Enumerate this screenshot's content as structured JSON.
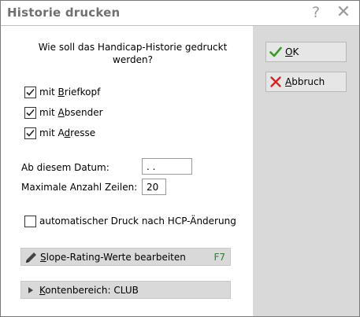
{
  "window": {
    "title": "Historie drucken",
    "help_glyph": "?",
    "close_glyph": "✕"
  },
  "question": "Wie soll das Handicap-Historie gedruckt werden?",
  "checkboxes": [
    {
      "pre": "mit ",
      "mnemonic": "B",
      "post": "riefkopf",
      "checked": true
    },
    {
      "pre": "mit ",
      "mnemonic": "A",
      "post": "bsender",
      "checked": true
    },
    {
      "pre": "mit A",
      "mnemonic": "d",
      "post": "resse",
      "checked": true
    }
  ],
  "fields": {
    "date_label": "Ab diesem Datum:",
    "date_value": " .  .",
    "max_rows_label": "Maximale Anzahl Zeilen:",
    "max_rows_value": "20"
  },
  "auto_print": {
    "label": "automatischer Druck nach HCP-Änderung",
    "checked": false
  },
  "slope_bar": {
    "mnemonic": "S",
    "rest": "lope-Rating-Werte bearbeiten",
    "shortcut": "F7"
  },
  "konten_bar": {
    "mnemonic": "K",
    "rest": "ontenbereich: CLUB"
  },
  "buttons": {
    "ok": {
      "mnemonic": "O",
      "rest": "K"
    },
    "cancel": {
      "mnemonic": "A",
      "rest": "bbruch"
    }
  },
  "colors": {
    "ok_icon": "#3a9a2a",
    "cancel_icon": "#d9231f",
    "shortcut": "#2e7d32"
  },
  "icons": {
    "help": "question-mark-icon",
    "close": "close-icon",
    "ok": "checkmark-icon",
    "cancel": "x-icon",
    "slope": "pencil-icon",
    "konten": "triangle-right-icon"
  }
}
